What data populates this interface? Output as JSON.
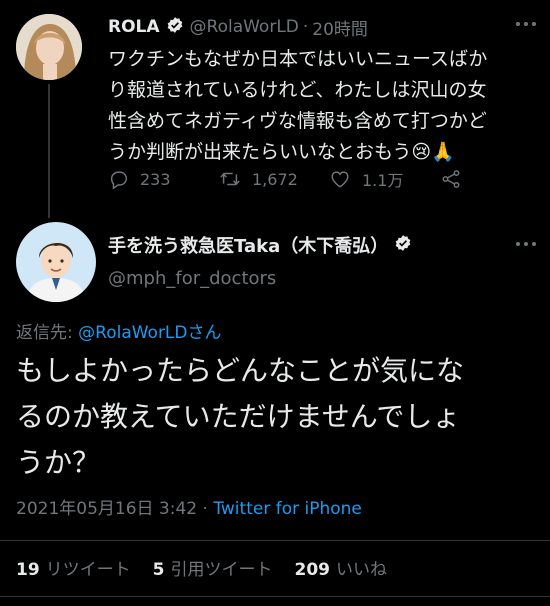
{
  "tweet1": {
    "author_name": "ROLA",
    "handle": "@RolaWorLD",
    "separator": "·",
    "time": "20時間",
    "text_lines": [
      "ワクチンもなぜか日本ではいいニュースばか",
      "り報道されているけれど、わたしは沢山の女",
      "性含めてネガティヴな情報も含めて打つかど",
      "うか判断が出来たらいいなとおもう😢🙏"
    ],
    "replies": "233",
    "retweets": "1,672",
    "likes": "1.1万"
  },
  "tweet2": {
    "author_name": "手を洗う救急医Taka（木下喬弘）",
    "handle": "@mph_for_doctors",
    "reply_to_label": "返信先: ",
    "reply_to_handle": "@RolaWorLDさん",
    "text_lines": [
      "もしよかったらどんなことが気にな",
      "るのか教えていただけませんでしょ",
      "うか？"
    ],
    "timestamp": "2021年05月16日 3:42 · ",
    "client": "Twitter for iPhone",
    "retweet_count": "19",
    "retweet_label": "リツイート",
    "quote_count": "5",
    "quote_label": "引用ツイート",
    "like_count": "209",
    "like_label": "いいね"
  },
  "colors": {
    "background": "#000000",
    "text": "#e7e9ea",
    "muted": "#71767b",
    "link": "#1d9bf0"
  }
}
